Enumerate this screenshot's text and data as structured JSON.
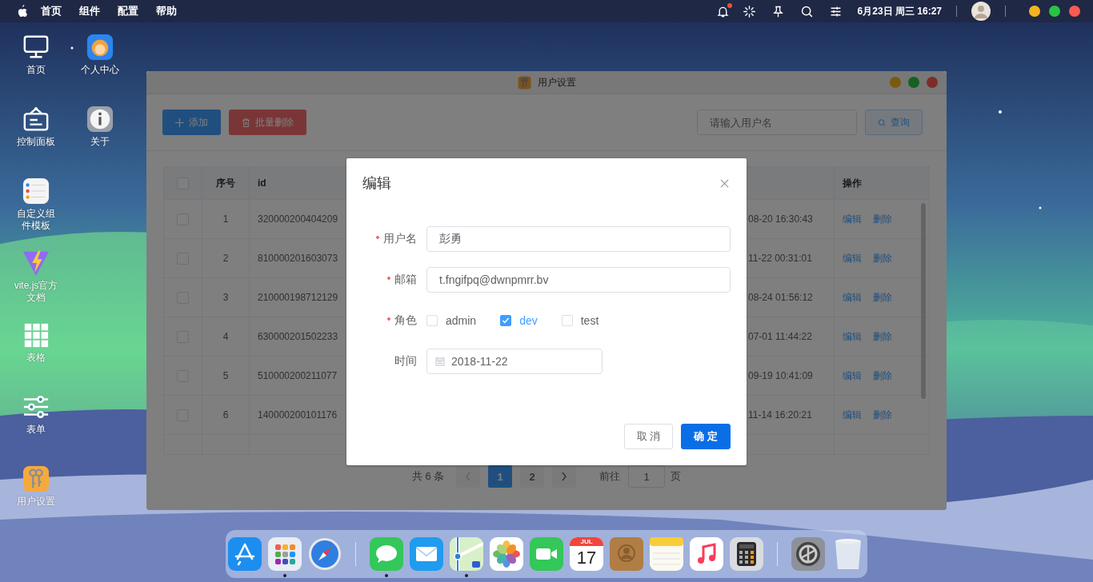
{
  "menubar": {
    "menus": [
      "首页",
      "组件",
      "配置",
      "帮助"
    ],
    "notification_unread": true,
    "datetime": "6月23日 周三 16:27"
  },
  "desktop": {
    "column_1": [
      {
        "label": "首页",
        "kind": "monitor"
      },
      {
        "label": "控制面板",
        "kind": "signboard"
      },
      {
        "label": "自定义组件模板",
        "kind": "list"
      },
      {
        "label": "vite.js官方文档",
        "kind": "vite"
      },
      {
        "label": "表格",
        "kind": "grid"
      },
      {
        "label": "表单",
        "kind": "sliders"
      },
      {
        "label": "用户设置",
        "kind": "keys"
      }
    ],
    "column_2": [
      {
        "label": "个人中心",
        "kind": "avatar"
      },
      {
        "label": "关于",
        "kind": "info"
      }
    ]
  },
  "window": {
    "title": "用户设置",
    "toolbar": {
      "add": "添加",
      "batch_delete": "批量删除",
      "search_placeholder": "请输入用户名",
      "query": "查询"
    },
    "table": {
      "header_checked": false,
      "columns": [
        "序号",
        "id",
        "操作"
      ],
      "rows": [
        {
          "checked": false,
          "index": "1",
          "id": "320000200404209",
          "time": "08-20 16:30:43",
          "actions": [
            "编辑",
            "删除"
          ]
        },
        {
          "checked": false,
          "index": "2",
          "id": "810000201603073",
          "time": "11-22 00:31:01",
          "actions": [
            "编辑",
            "删除"
          ]
        },
        {
          "checked": false,
          "index": "3",
          "id": "210000198712129",
          "time": "08-24 01:56:12",
          "actions": [
            "编辑",
            "删除"
          ]
        },
        {
          "checked": false,
          "index": "4",
          "id": "630000201502233",
          "time": "07-01 11:44:22",
          "actions": [
            "编辑",
            "删除"
          ]
        },
        {
          "checked": false,
          "index": "5",
          "id": "510000200211077",
          "time": "09-19 10:41:09",
          "actions": [
            "编辑",
            "删除"
          ]
        },
        {
          "checked": false,
          "index": "6",
          "id": "140000200101176",
          "time": "11-14 16:20:21",
          "actions": [
            "编辑",
            "删除"
          ]
        }
      ]
    },
    "pagination": {
      "total": "共 6 条",
      "pages": [
        {
          "label": "1",
          "selected": true
        },
        {
          "label": "2",
          "selected": false
        }
      ],
      "goto_label": "前往",
      "goto_value": "1",
      "page_suffix": "页"
    }
  },
  "dialog": {
    "title": "编辑",
    "fields": [
      {
        "kind": "text",
        "label": "用户名",
        "required": true,
        "value": "彭勇"
      },
      {
        "kind": "text",
        "label": "邮箱",
        "required": true,
        "value": "t.fngifpq@dwnpmrr.bv"
      },
      {
        "kind": "checkboxes",
        "label": "角色",
        "required": true,
        "options": [
          {
            "label": "admin",
            "checked": false
          },
          {
            "label": "dev",
            "checked": true
          },
          {
            "label": "test",
            "checked": false
          }
        ]
      },
      {
        "kind": "date",
        "label": "时间",
        "required": false,
        "value": "2018-11-22"
      }
    ],
    "buttons": [
      {
        "label": "取 消",
        "kind": "default"
      },
      {
        "label": "确 定",
        "kind": "primary"
      }
    ]
  },
  "dock": [
    {
      "kind": "appstore",
      "running": false
    },
    {
      "kind": "launchpad",
      "running": true
    },
    {
      "kind": "safari",
      "running": false
    },
    {
      "kind": "separator"
    },
    {
      "kind": "messages",
      "running": true
    },
    {
      "kind": "mail",
      "running": false
    },
    {
      "kind": "maps",
      "running": true
    },
    {
      "kind": "photos",
      "running": false
    },
    {
      "kind": "facetime",
      "running": false
    },
    {
      "kind": "calendar",
      "running": false,
      "month": "JUL",
      "day": "17"
    },
    {
      "kind": "contacts",
      "running": false
    },
    {
      "kind": "notes",
      "running": false
    },
    {
      "kind": "music",
      "running": false
    },
    {
      "kind": "calculator",
      "running": false
    },
    {
      "kind": "separator"
    },
    {
      "kind": "settings",
      "running": false
    },
    {
      "kind": "trash",
      "running": false
    }
  ]
}
